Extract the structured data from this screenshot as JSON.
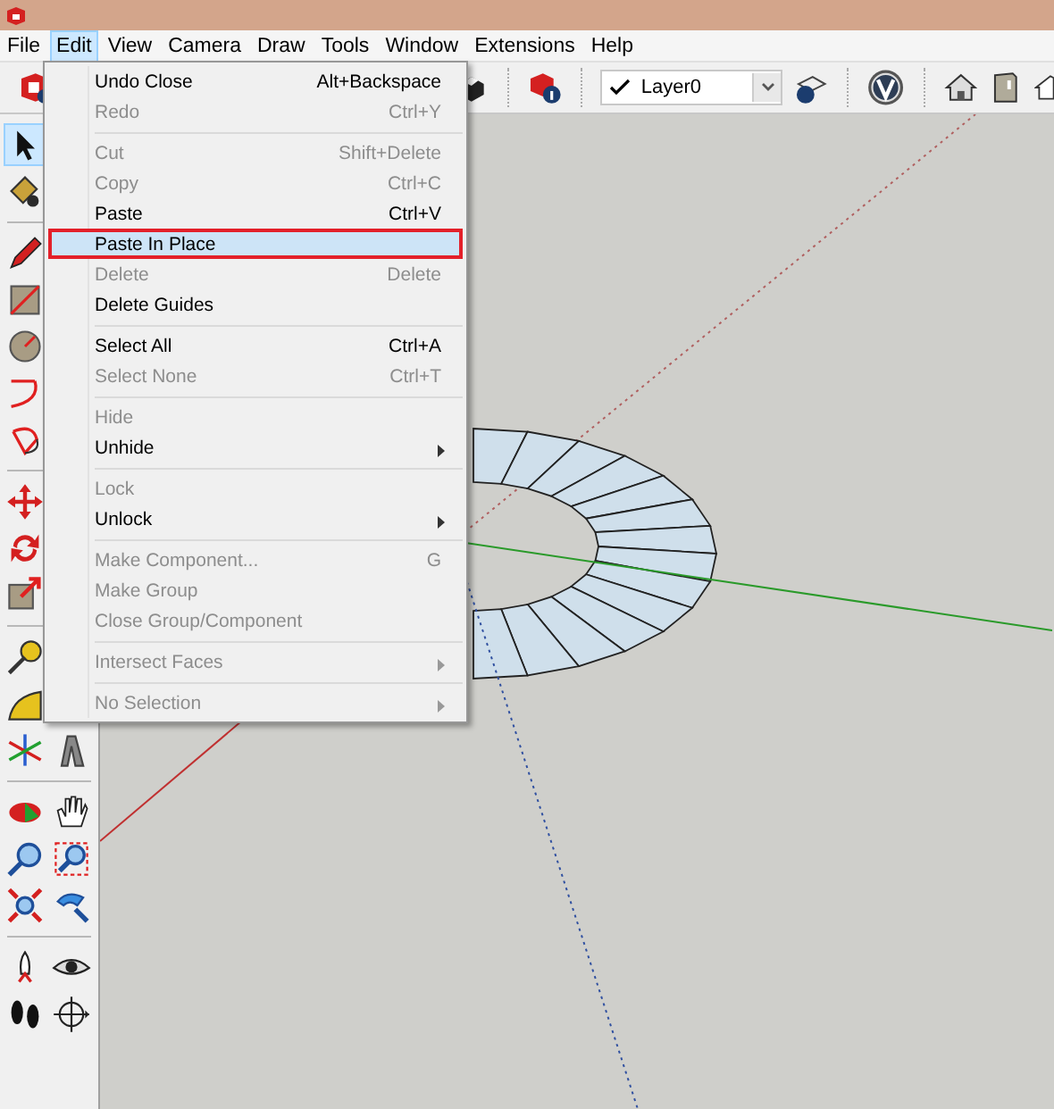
{
  "menu_bar": [
    {
      "label": "File",
      "selected": false
    },
    {
      "label": "Edit",
      "selected": true
    },
    {
      "label": "View",
      "selected": false
    },
    {
      "label": "Camera",
      "selected": false
    },
    {
      "label": "Draw",
      "selected": false
    },
    {
      "label": "Tools",
      "selected": false
    },
    {
      "label": "Window",
      "selected": false
    },
    {
      "label": "Extensions",
      "selected": false
    },
    {
      "label": "Help",
      "selected": false
    }
  ],
  "toolbar": {
    "layer_dropdown": {
      "value": "Layer0"
    }
  },
  "edit_menu": {
    "groups": [
      [
        {
          "label": "Undo Close",
          "shortcut": "Alt+Backspace",
          "disabled": false,
          "submenu": false,
          "selected": false
        },
        {
          "label": "Redo",
          "shortcut": "Ctrl+Y",
          "disabled": true,
          "submenu": false,
          "selected": false
        }
      ],
      [
        {
          "label": "Cut",
          "shortcut": "Shift+Delete",
          "disabled": true,
          "submenu": false,
          "selected": false
        },
        {
          "label": "Copy",
          "shortcut": "Ctrl+C",
          "disabled": true,
          "submenu": false,
          "selected": false
        },
        {
          "label": "Paste",
          "shortcut": "Ctrl+V",
          "disabled": false,
          "submenu": false,
          "selected": false
        },
        {
          "label": "Paste In Place",
          "disabled": false,
          "submenu": false,
          "selected": true
        },
        {
          "label": "Delete",
          "shortcut": "Delete",
          "disabled": true,
          "submenu": false,
          "selected": false
        },
        {
          "label": "Delete Guides",
          "disabled": false,
          "submenu": false,
          "selected": false
        }
      ],
      [
        {
          "label": "Select All",
          "shortcut": "Ctrl+A",
          "disabled": false,
          "submenu": false,
          "selected": false
        },
        {
          "label": "Select None",
          "shortcut": "Ctrl+T",
          "disabled": true,
          "submenu": false,
          "selected": false
        }
      ],
      [
        {
          "label": "Hide",
          "disabled": true,
          "submenu": false,
          "selected": false
        },
        {
          "label": "Unhide",
          "disabled": false,
          "submenu": true,
          "selected": false
        }
      ],
      [
        {
          "label": "Lock",
          "disabled": true,
          "submenu": false,
          "selected": false
        },
        {
          "label": "Unlock",
          "disabled": false,
          "submenu": true,
          "selected": false
        }
      ],
      [
        {
          "label": "Make Component...",
          "shortcut": "G",
          "disabled": true,
          "submenu": false,
          "selected": false
        },
        {
          "label": "Make Group",
          "disabled": true,
          "submenu": false,
          "selected": false
        },
        {
          "label": "Close Group/Component",
          "disabled": true,
          "submenu": false,
          "selected": false
        }
      ],
      [
        {
          "label": "Intersect Faces",
          "disabled": true,
          "submenu": true,
          "selected": false
        }
      ],
      [
        {
          "label": "No Selection",
          "disabled": true,
          "submenu": true,
          "selected": false
        }
      ]
    ]
  }
}
